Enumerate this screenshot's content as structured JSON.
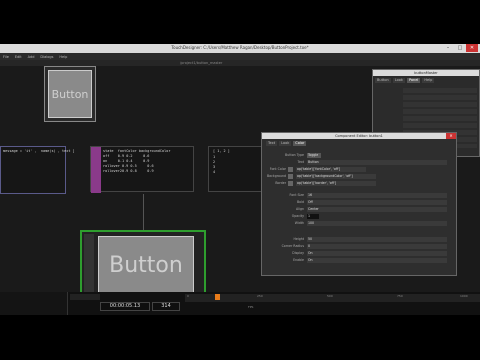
{
  "window": {
    "title": "TouchDesigner: C:/Users/Matthew Ragan/Desktop/ButtonProject.toe*"
  },
  "menubar": {
    "items": [
      "File",
      "Edit",
      "Add",
      "Dialogs",
      "Help"
    ]
  },
  "pathbar": {
    "path": "/project1/button_master"
  },
  "nodes": {
    "button_top": {
      "title": "button1",
      "preview_text": "Button"
    },
    "text_left": {
      "lines": [
        "message = 'it' ,  name(s) , text ]"
      ]
    },
    "table": {
      "rows": [
        [
          "state",
          "fontColor",
          "backgroundColor"
        ],
        [
          "off",
          "0.9 0.2",
          "0.6"
        ],
        [
          "on",
          "0.1 0.4",
          "0.9"
        ],
        [
          "rollover",
          "0.9 0.5",
          "0.6"
        ],
        [
          "rollover2",
          "0.9 0.8",
          "0.9"
        ]
      ]
    },
    "list_node": {
      "lines": [
        "[ 1, 2 ]",
        "1",
        "2",
        "3",
        "4"
      ]
    },
    "button_big": {
      "preview_text": "Button"
    }
  },
  "dialog_back": {
    "title": "buttonMaster",
    "tabs": [
      "Button",
      "Look",
      "Panel",
      "Help"
    ]
  },
  "dialog": {
    "title": "Component Editor: button1",
    "close": "✕",
    "tabs": [
      "Text",
      "Look",
      "Color"
    ],
    "rows": [
      {
        "label": "Button Type",
        "value": "Toggle"
      },
      {
        "label": "Text",
        "value": "Button"
      },
      {
        "label": "Font Color",
        "value": "op('table')['fontColor', 'off']"
      },
      {
        "label": "Background",
        "value": "op('table')['backgroundColor', 'off']"
      },
      {
        "label": "Border",
        "value": "op('table')['border', 'off']"
      },
      {
        "label": "Font Size",
        "value": "16"
      },
      {
        "label": "Bold",
        "value": "Off"
      },
      {
        "label": "Align",
        "value": "Center"
      },
      {
        "label": "Opacity",
        "value": "1"
      },
      {
        "label": "Width",
        "value": "100"
      },
      {
        "label": "Height",
        "value": "50"
      },
      {
        "label": "Corner Radius",
        "value": "0"
      },
      {
        "label": "Display",
        "value": "On"
      },
      {
        "label": "Enable",
        "value": "On"
      }
    ]
  },
  "timeline": {
    "timecode": "00:00:05.13",
    "frame": "314",
    "fps_label": "FPS",
    "ruler_ticks": [
      "0",
      "250",
      "500",
      "750",
      "1000"
    ]
  },
  "colors": {
    "accent": "#e87b1a",
    "selected_border": "#2e9e2e",
    "node_purple": "#8a3a8a"
  }
}
